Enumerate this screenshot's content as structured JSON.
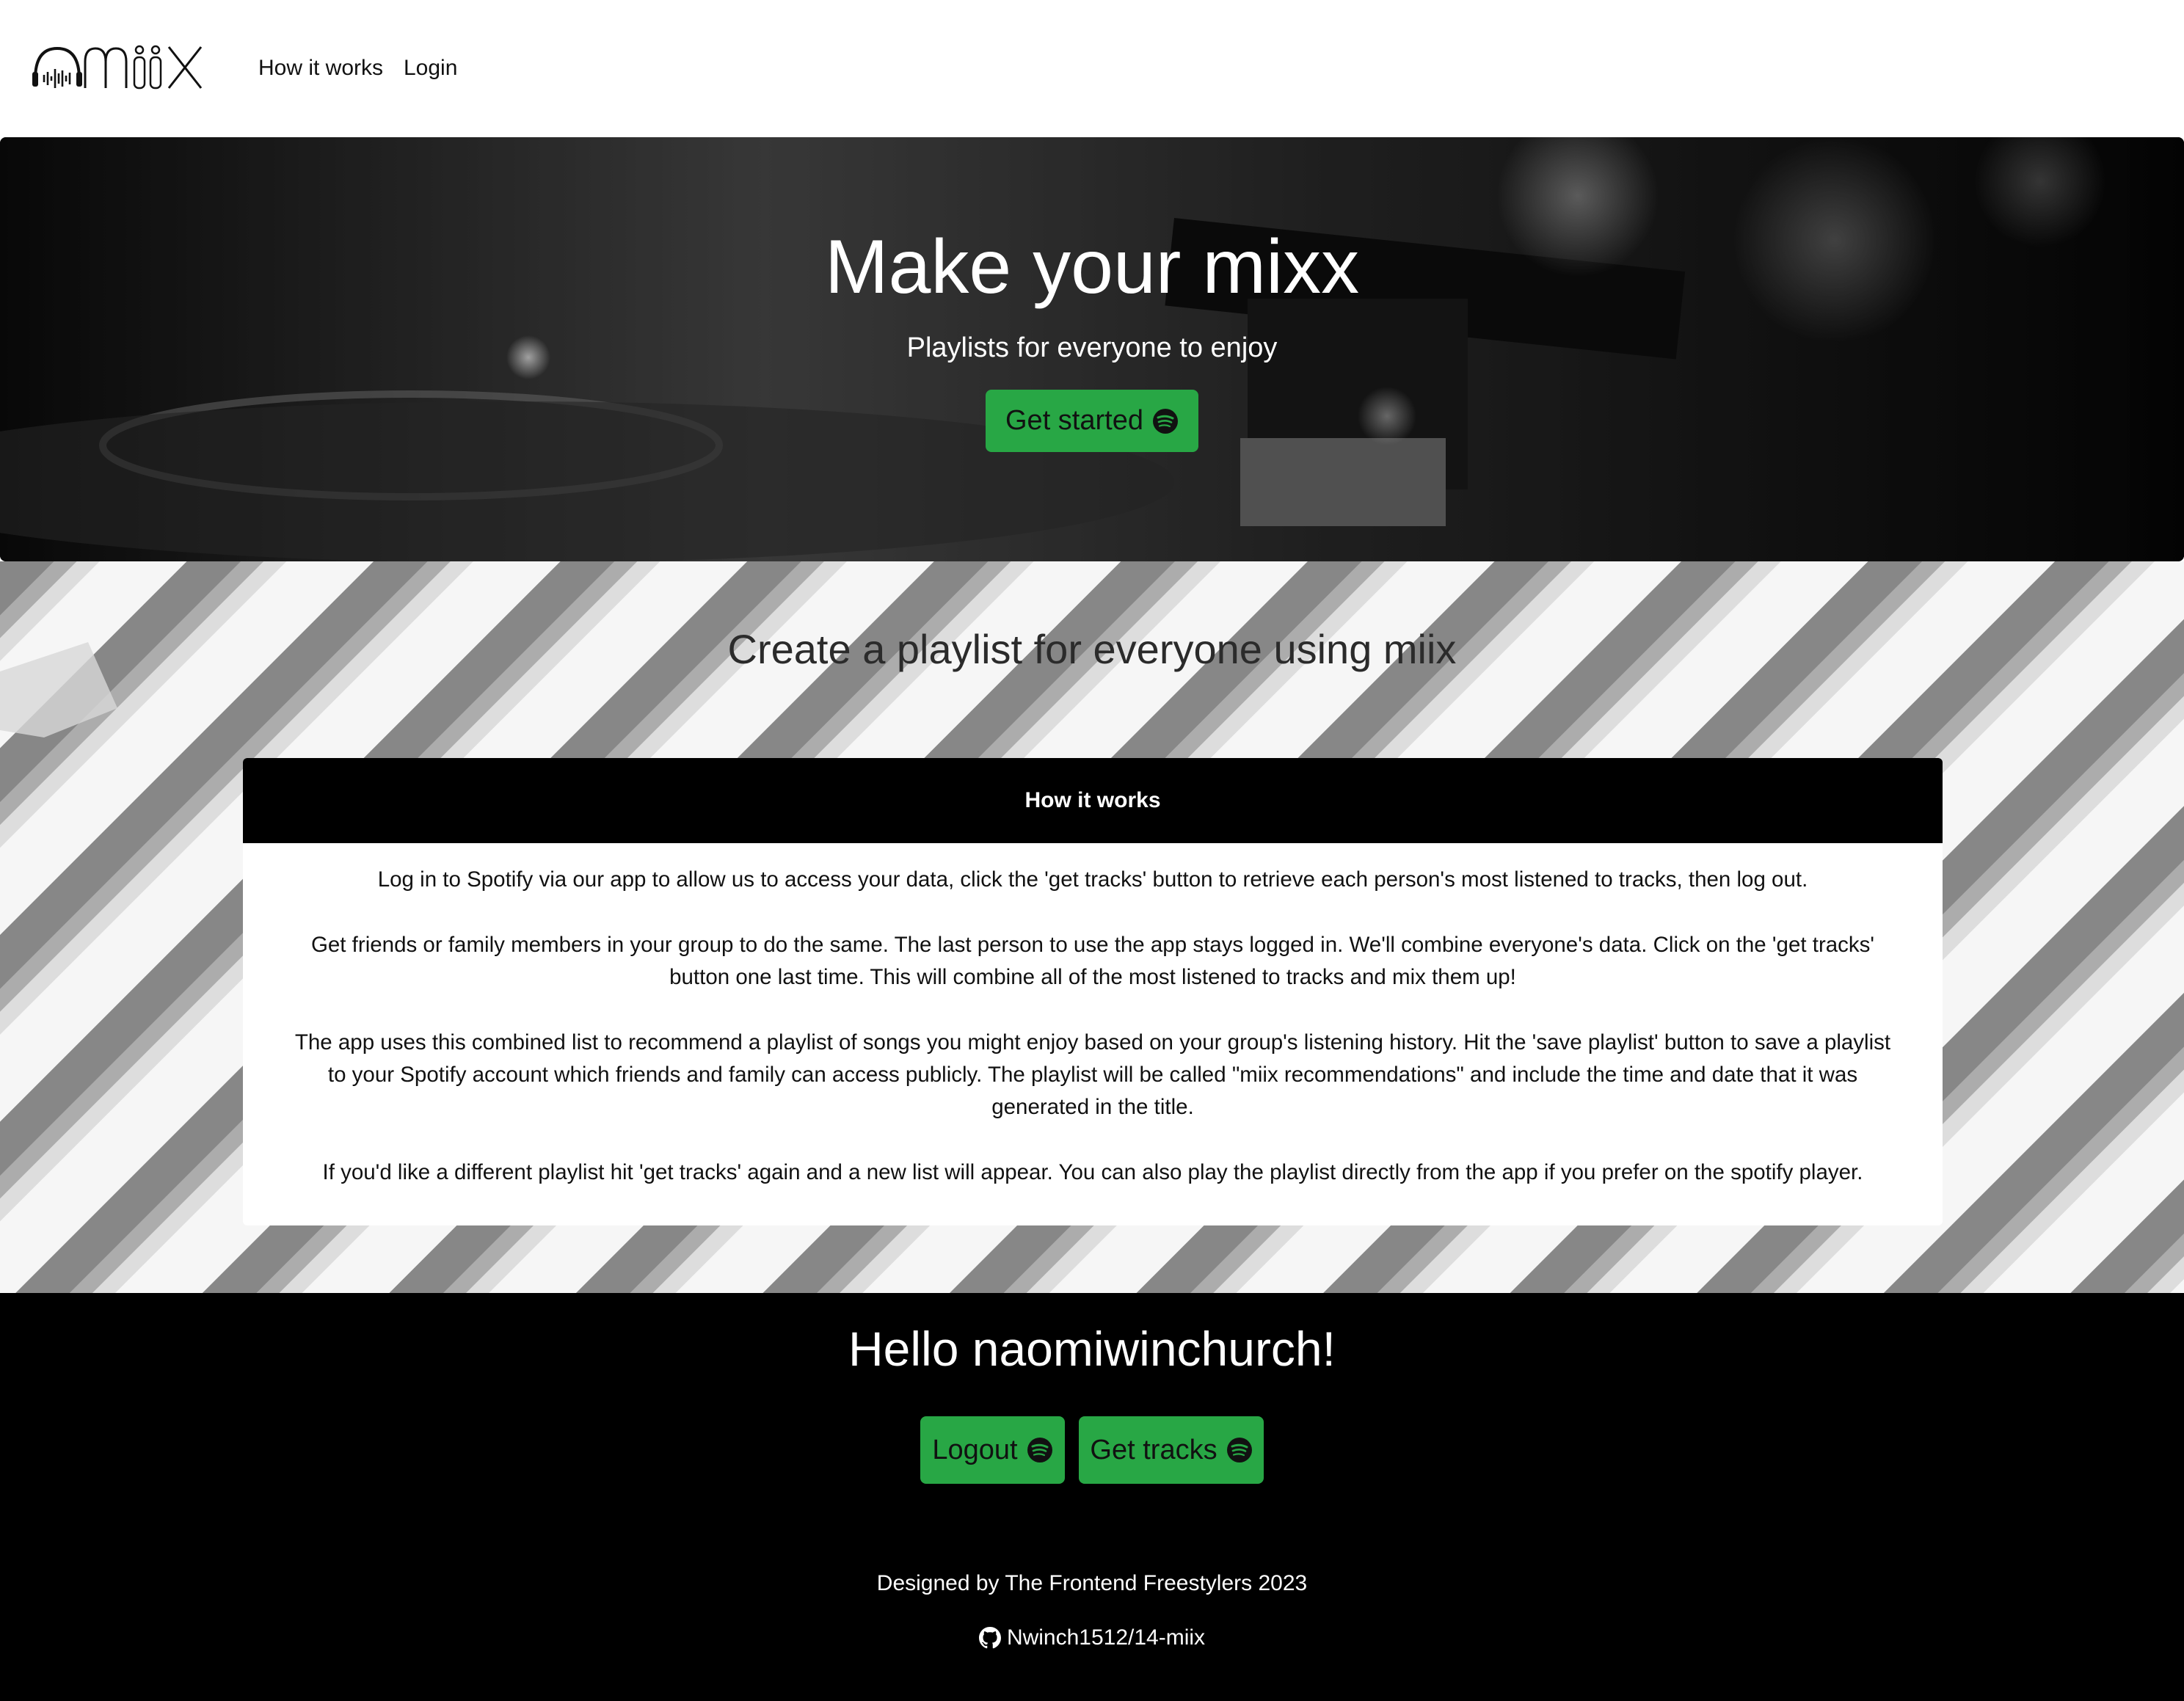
{
  "brand": {
    "logo_text": "miix"
  },
  "nav": {
    "how_it_works": "How it works",
    "login": "Login"
  },
  "hero": {
    "title": "Make your mixx",
    "subtitle": "Playlists for everyone to enjoy",
    "cta_label": "Get started",
    "cta_icon": "spotify-icon"
  },
  "section": {
    "title": "Create a playlist for everyone using miix"
  },
  "how_it_works": {
    "header": "How it works",
    "paragraphs": [
      "Log in to Spotify via our app to allow us to access your data, click the 'get tracks' button to retrieve each person's most listened to tracks, then log out.",
      "Get friends or family members in your group to do the same. The last person to use the app stays logged in. We'll combine everyone's data. Click on the 'get tracks' button one last time. This will combine all of the most listened to tracks and mix them up!",
      "The app uses this combined list to recommend a playlist of songs you might enjoy based on your group's listening history. Hit the 'save playlist' button to save a playlist to your Spotify account which friends and family can access publicly. The playlist will be called \"miix recommendations\" and include the time and date that it was generated in the title.",
      "If you'd like a different playlist hit 'get tracks' again and a new list will appear. You can also play the playlist directly from the app if you prefer on the spotify player."
    ]
  },
  "user": {
    "greeting": "Hello naomiwinchurch!",
    "logout_label": "Logout",
    "get_tracks_label": "Get tracks"
  },
  "footer": {
    "credit": "Designed by The Frontend Freestylers 2023",
    "repo": "Nwinch1512/14-miix",
    "repo_icon": "github-icon"
  },
  "colors": {
    "accent": "#28a745",
    "dark": "#000000",
    "text": "#212529"
  }
}
